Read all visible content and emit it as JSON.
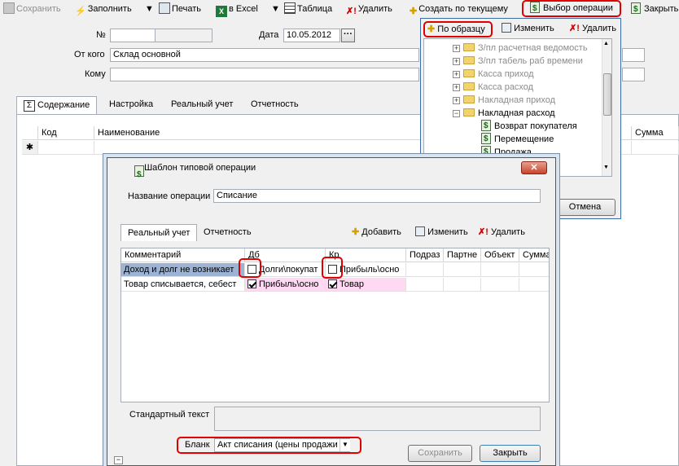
{
  "toolbar": {
    "save": "Сохранить",
    "fill": "Заполнить",
    "print": "Печать",
    "excel": "в Excel",
    "table": "Таблица",
    "delete": "Удалить",
    "create_by_current": "Создать по текущему",
    "select_operation": "Выбор операции",
    "close": "Закрыть"
  },
  "form": {
    "number_label": "№",
    "number_value": "",
    "date_label": "Дата",
    "date_value": "10.05.2012",
    "from_label": "От кого",
    "from_value": "Склад основной",
    "to_label": "Кому",
    "to_value": ""
  },
  "tabs": [
    "Содержание",
    "Настройка",
    "Реальный учет",
    "Отчетность"
  ],
  "grid": {
    "headers": {
      "code": "Код",
      "name": "Наименование",
      "sum": "Сумма"
    },
    "new_row_marker": "✱"
  },
  "popup": {
    "by_sample": "По образцу",
    "edit": "Изменить",
    "delete": "Удалить",
    "tree": [
      {
        "label": "З/пл расчетная ведомость",
        "type": "folder",
        "disabled": true
      },
      {
        "label": "З/пл табель раб времени",
        "type": "folder",
        "disabled": true
      },
      {
        "label": "Касса приход",
        "type": "folder",
        "disabled": true
      },
      {
        "label": "Касса расход",
        "type": "folder",
        "disabled": true
      },
      {
        "label": "Накладная приход",
        "type": "folder",
        "disabled": true
      },
      {
        "label": "Накладная расход",
        "type": "folder-open",
        "disabled": false
      },
      {
        "label": "Возврат покупателя",
        "type": "doc",
        "disabled": false
      },
      {
        "label": "Перемещение",
        "type": "doc",
        "disabled": false
      },
      {
        "label": "Продажа",
        "type": "doc",
        "disabled": false
      }
    ],
    "cancel": "Отмена"
  },
  "dialog": {
    "title": "Шаблон типовой операции",
    "close_symbol": "✕",
    "op_name_label": "Название операции",
    "op_name_value": "Списание",
    "tabs": [
      "Реальный учет",
      "Отчетность"
    ],
    "add": "Добавить",
    "edit": "Изменить",
    "delete": "Удалить",
    "headers": {
      "comment": "Комментарий",
      "db": "Дб",
      "kr": "Кр",
      "subdiv": "Подраз",
      "partner": "Партне",
      "object": "Объект",
      "sum": "Сумма"
    },
    "rows": [
      {
        "comment": "Доход и долг не возникает",
        "db_checked": false,
        "db": "Долги\\покупат",
        "kr_checked": false,
        "kr": "Прибыль\\осно"
      },
      {
        "comment": "Товар списывается, себест",
        "db_checked": true,
        "db": "Прибыль\\осно",
        "kr_checked": true,
        "kr": "Товар"
      }
    ],
    "std_text_label": "Стандартный текст",
    "std_text_value": "",
    "blank_label": "Бланк",
    "blank_value": "Акт списания (цены продажи",
    "save": "Сохранить",
    "close": "Закрыть"
  }
}
